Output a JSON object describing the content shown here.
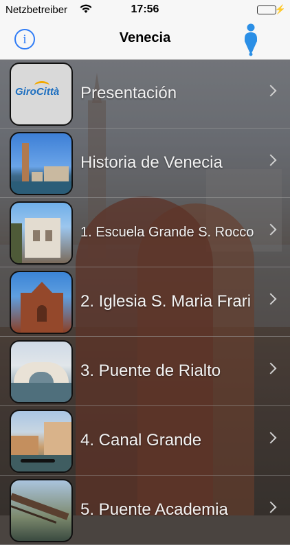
{
  "status_bar": {
    "carrier": "Netzbetreiber",
    "time": "17:56",
    "battery_level": 1.0,
    "battery_color": "#4cd964",
    "icons": [
      "wifi-icon",
      "battery-icon",
      "charging-bolt-icon"
    ]
  },
  "navbar": {
    "title": "Venecia",
    "info_icon": "info-icon",
    "location_icon": "map-pin-person-icon",
    "accent_color": "#2f7cf6"
  },
  "list": {
    "items": [
      {
        "label": "Presentación",
        "thumb": "girocitta-logo",
        "logo_text": "GiroCittà"
      },
      {
        "label": "Historia de Venecia",
        "thumb": "campanile-photo"
      },
      {
        "label": "1. Escuela Grande S. Rocco",
        "thumb": "scuola-rocco-photo"
      },
      {
        "label": "2. Iglesia S. Maria Frari",
        "thumb": "frari-church-photo"
      },
      {
        "label": "3. Puente de Rialto",
        "thumb": "rialto-bridge-photo"
      },
      {
        "label": "4. Canal Grande",
        "thumb": "grand-canal-photo"
      },
      {
        "label": "5. Puente Academia",
        "thumb": "academia-bridge-photo"
      }
    ]
  }
}
